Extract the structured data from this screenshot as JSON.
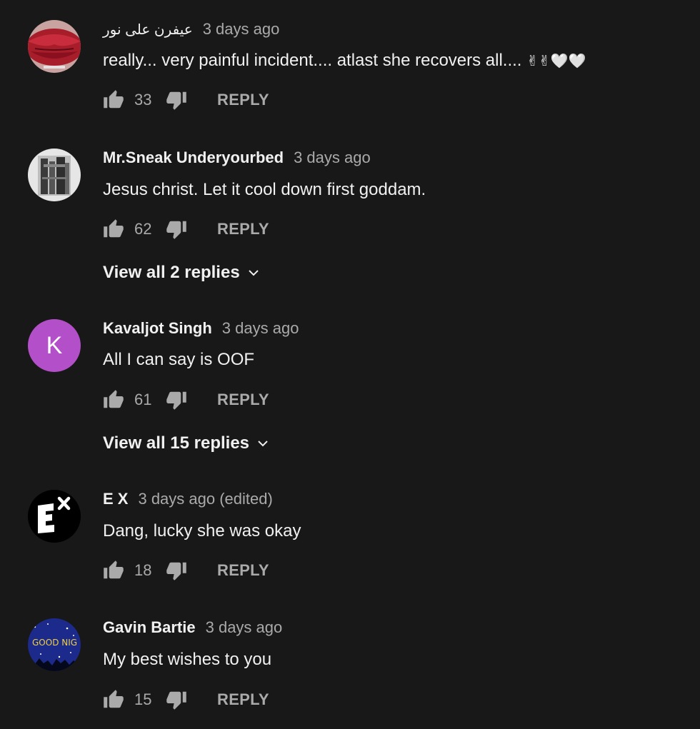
{
  "comments": [
    {
      "author": "عیفرن علی نور",
      "time": "3 days ago",
      "text": "really... very painful incident.... atlast she recovers all.... ",
      "emoji": "✌✌🤍🤍",
      "likes": "33",
      "reply_label": "REPLY",
      "avatar_icon": "lips-avatar"
    },
    {
      "author": "Mr.Sneak Underyourbed",
      "time": "3 days ago",
      "text": "Jesus christ. Let it cool down first goddam.",
      "likes": "62",
      "reply_label": "REPLY",
      "view_replies": "View all 2 replies",
      "avatar_icon": "photo-avatar"
    },
    {
      "author": "Kavaljot Singh",
      "time": "3 days ago",
      "text": "All I can say is OOF",
      "likes": "61",
      "reply_label": "REPLY",
      "view_replies": "View all 15 replies",
      "avatar_letter": "K",
      "avatar_color": "#b34fc9"
    },
    {
      "author": "E X",
      "time": "3 days ago (edited)",
      "text": "Dang, lucky she was okay",
      "likes": "18",
      "reply_label": "REPLY",
      "avatar_icon": "ex-logo-avatar"
    },
    {
      "author": "Gavin Bartie",
      "time": "3 days ago",
      "text": "My best wishes to you",
      "likes": "15",
      "reply_label": "REPLY",
      "avatar_text": "GOOD NIG",
      "avatar_icon": "good-night-avatar"
    }
  ],
  "colors": {
    "background": "#181818",
    "primary_text": "#f1f1f1",
    "secondary_text": "#aaaaaa"
  }
}
